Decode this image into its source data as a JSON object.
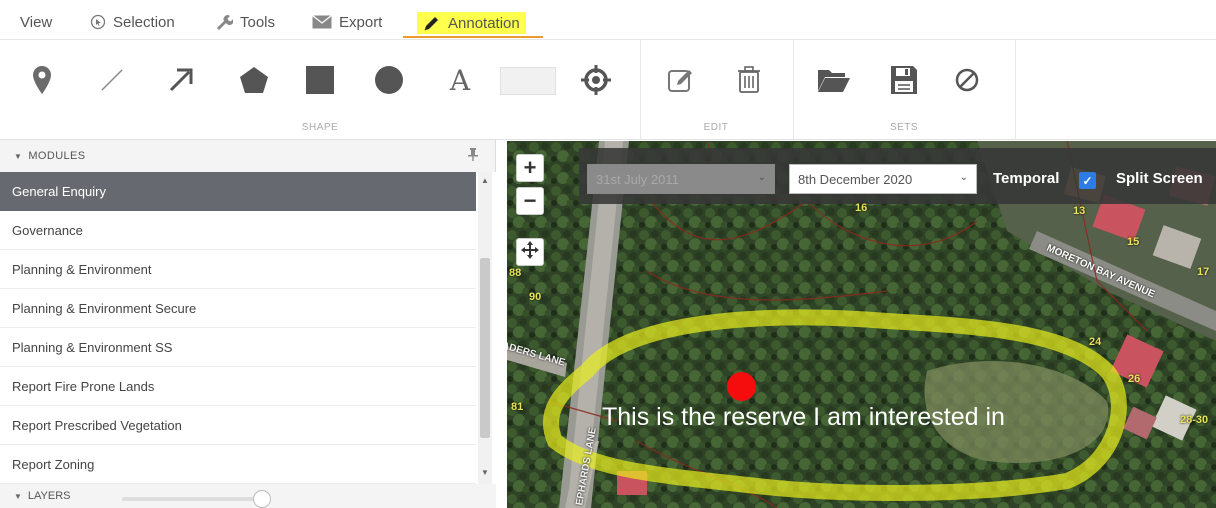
{
  "menu": {
    "view": "View",
    "selection": "Selection",
    "tools": "Tools",
    "export": "Export",
    "annotation": "Annotation"
  },
  "ribbon": {
    "groups": {
      "shape": "SHAPE",
      "edit": "EDIT",
      "sets": "SETS"
    },
    "text_tool_glyph": "A",
    "icons": [
      "point-marker-icon",
      "line-icon",
      "arrow-icon",
      "polygon-icon",
      "rectangle-icon",
      "circle-icon",
      "text-icon",
      "color-swatch",
      "target-icon",
      "edit-icon",
      "trash-icon",
      "open-folder-icon",
      "save-icon",
      "clear-icon"
    ]
  },
  "panel": {
    "modules_title": "MODULES",
    "items": [
      {
        "label": "General Enquiry",
        "selected": true
      },
      {
        "label": "Governance"
      },
      {
        "label": "Planning & Environment"
      },
      {
        "label": "Planning & Environment Secure"
      },
      {
        "label": "Planning & Environment SS"
      },
      {
        "label": "Report Fire Prone Lands"
      },
      {
        "label": "Report Prescribed Vegetation"
      },
      {
        "label": "Report Zoning"
      }
    ],
    "layers_title": "LAYERS"
  },
  "map": {
    "zoom_in": "+",
    "zoom_out": "−",
    "date_left": "31st July 2011",
    "date_right": "8th December 2020",
    "temporal_label": "Temporal",
    "temporal_checked": true,
    "split_label": "Split Screen",
    "labels": {
      "moreton": "MORETON BAY AVENUE",
      "road_left": "ADERS LANE",
      "road_bottom": "EPHARDS LANE",
      "n16": "16",
      "n13": "13",
      "n15": "15",
      "n17": "17",
      "n24": "24",
      "n26": "26",
      "n2830": "28-30",
      "n88": "88",
      "n90": "90",
      "n81": "81"
    },
    "annotation_text": "This is the reserve I am interested in"
  },
  "colors": {
    "accent_orange": "#ee9a32",
    "highlight_yellow": "#ffff4d",
    "selected_row": "#666a70",
    "checkbox_blue": "#2d7be5",
    "annotation_red": "#f50c0c"
  }
}
